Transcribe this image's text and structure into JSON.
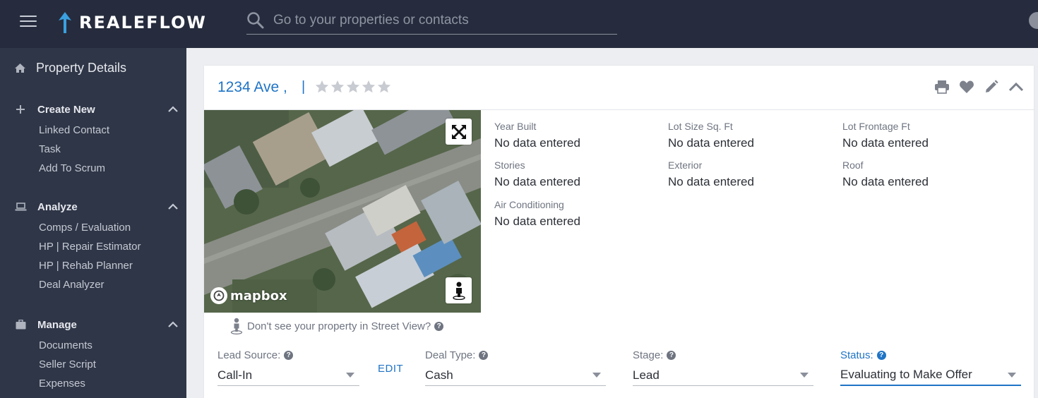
{
  "app": {
    "brand": "REALEFLOW"
  },
  "search": {
    "placeholder": "Go to your properties or contacts"
  },
  "sidebar": {
    "title": "Property Details",
    "sections": [
      {
        "label": "Create New",
        "items": [
          "Linked Contact",
          "Task",
          "Add To Scrum"
        ]
      },
      {
        "label": "Analyze",
        "items": [
          "Comps / Evaluation",
          "HP | Repair Estimator",
          "HP | Rehab Planner",
          "Deal Analyzer"
        ]
      },
      {
        "label": "Manage",
        "items": [
          "Documents",
          "Seller Script",
          "Expenses"
        ]
      }
    ]
  },
  "property": {
    "address": "1234 Ave ,",
    "separator": "|",
    "rating": {
      "value": 0,
      "max": 5
    },
    "details": [
      {
        "label": "Year Built",
        "value": "No data entered"
      },
      {
        "label": "Lot Size Sq. Ft",
        "value": "No data entered"
      },
      {
        "label": "Lot Frontage Ft",
        "value": "No data entered"
      },
      {
        "label": "Stories",
        "value": "No data entered"
      },
      {
        "label": "Exterior",
        "value": "No data entered"
      },
      {
        "label": "Roof",
        "value": "No data entered"
      },
      {
        "label": "Air Conditioning",
        "value": "No data entered"
      }
    ],
    "street_view_note": "Don't see your property in Street View?",
    "map_attribution": "mapbox"
  },
  "deal": {
    "lead_source": {
      "label": "Lead Source:",
      "value": "Call-In"
    },
    "edit_label": "EDIT",
    "deal_type": {
      "label": "Deal Type:",
      "value": "Cash"
    },
    "stage": {
      "label": "Stage:",
      "value": "Lead"
    },
    "status": {
      "label": "Status:",
      "value": "Evaluating to Make Offer"
    }
  },
  "colors": {
    "topbar": "#262c3d",
    "sidebar": "#2f3647",
    "accent": "#1f74c6",
    "logo_accent": "#3aa0e0"
  },
  "icons": {
    "menu": "hamburger-icon",
    "search": "search-icon",
    "home": "home-icon",
    "create": "plus-icon",
    "analyze": "laptop-icon",
    "manage": "briefcase-icon",
    "print": "print-icon",
    "favorite": "heart-icon",
    "edit": "pencil-icon",
    "collapse": "chevron-up-icon",
    "fullscreen": "expand-icon",
    "street_view": "pegman-icon"
  }
}
